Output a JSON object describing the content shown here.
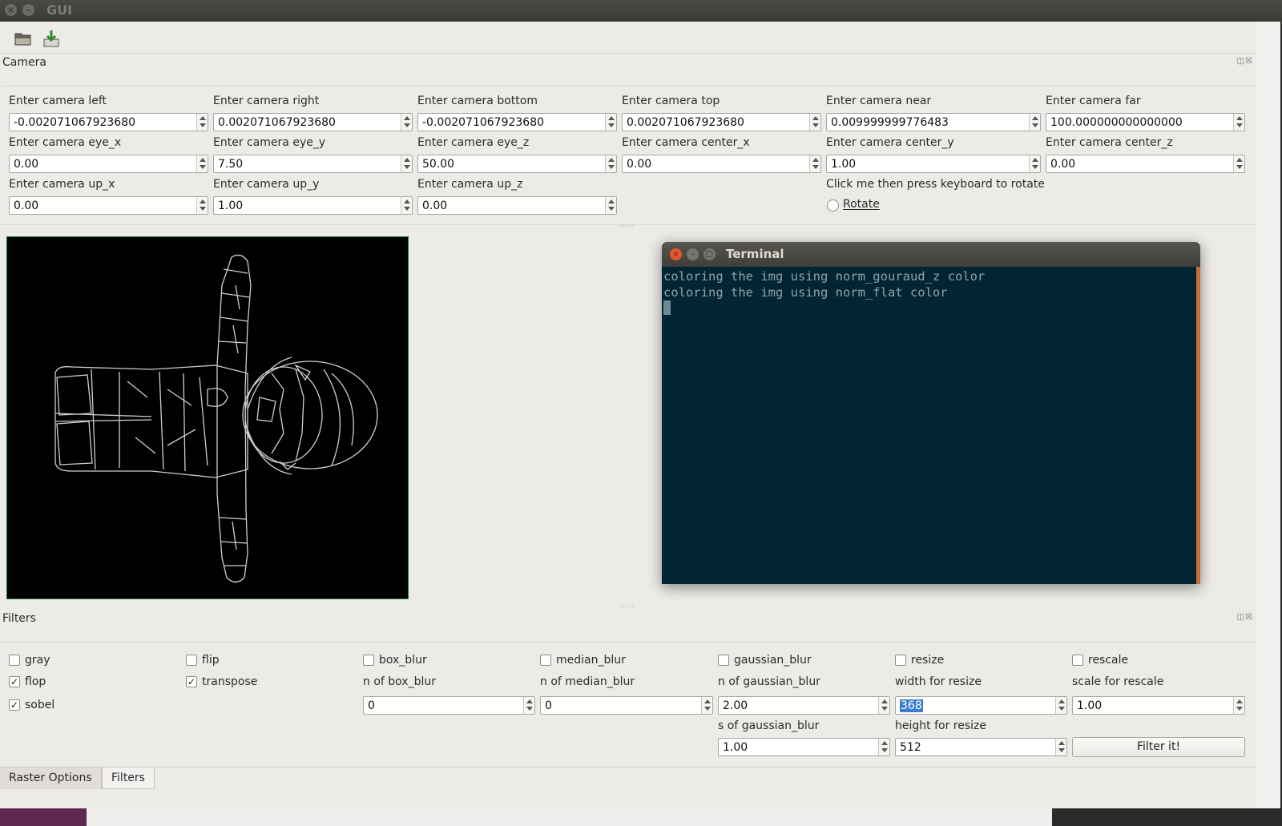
{
  "window": {
    "title": "GUI"
  },
  "toolbar": {
    "open_icon": "folder-open-icon",
    "save_icon": "save-download-icon"
  },
  "camera": {
    "title": "Camera",
    "fields": [
      {
        "label": "Enter camera left",
        "value": "-0.002071067923680"
      },
      {
        "label": "Enter camera right",
        "value": "0.002071067923680"
      },
      {
        "label": "Enter camera bottom",
        "value": "-0.002071067923680"
      },
      {
        "label": "Enter camera top",
        "value": "0.002071067923680"
      },
      {
        "label": "Enter camera near",
        "value": "0.009999999776483"
      },
      {
        "label": "Enter camera far",
        "value": "100.000000000000000"
      },
      {
        "label": "Enter camera eye_x",
        "value": "0.00"
      },
      {
        "label": "Enter camera eye_y",
        "value": "7.50"
      },
      {
        "label": "Enter camera eye_z",
        "value": "50.00"
      },
      {
        "label": "Enter camera center_x",
        "value": "0.00"
      },
      {
        "label": "Enter camera center_y",
        "value": "1.00"
      },
      {
        "label": "Enter camera center_z",
        "value": "0.00"
      },
      {
        "label": "Enter camera up_x",
        "value": "0.00"
      },
      {
        "label": "Enter camera up_y",
        "value": "1.00"
      },
      {
        "label": "Enter camera up_z",
        "value": "0.00"
      }
    ],
    "rotate_hint": "Click me then press keyboard to rotate",
    "rotate_label": "Rotate",
    "rotate_checked": false
  },
  "terminal": {
    "title": "Terminal",
    "lines": [
      "coloring the img using norm_gouraud_z color",
      "coloring the img using norm_flat color"
    ]
  },
  "filters": {
    "title": "Filters",
    "checks": [
      {
        "label": "gray",
        "checked": false
      },
      {
        "label": "flip",
        "checked": false
      },
      {
        "label": "box_blur",
        "checked": false
      },
      {
        "label": "median_blur",
        "checked": false
      },
      {
        "label": "gaussian_blur",
        "checked": false
      },
      {
        "label": "resize",
        "checked": false
      },
      {
        "label": "rescale",
        "checked": false
      },
      {
        "label": "flop",
        "checked": true
      },
      {
        "label": "transpose",
        "checked": true
      },
      {
        "label": "sobel",
        "checked": true
      }
    ],
    "params": [
      {
        "label": "n of box_blur",
        "value": "0"
      },
      {
        "label": "n of median_blur",
        "value": "0"
      },
      {
        "label": "n of gaussian_blur",
        "value": "2.00"
      },
      {
        "label": "width for resize",
        "value": "368"
      },
      {
        "label": "scale for rescale",
        "value": "1.00"
      },
      {
        "label": "s of gaussian_blur",
        "value": "1.00"
      },
      {
        "label": "height for resize",
        "value": "512"
      }
    ],
    "filter_button": "Filter it!"
  },
  "tabs": [
    {
      "label": "Raster Options",
      "active": false
    },
    {
      "label": "Filters",
      "active": true
    }
  ]
}
